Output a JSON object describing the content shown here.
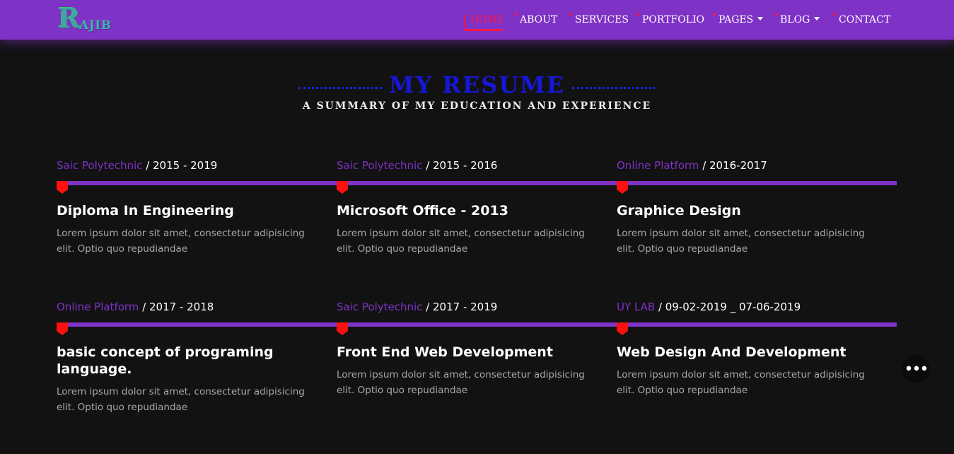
{
  "brand": {
    "logo_letter": "R",
    "logo_text": "AJIB"
  },
  "nav": {
    "items": [
      {
        "label": "HOME",
        "active": true
      },
      {
        "label": "ABOUT"
      },
      {
        "label": "SERVICES"
      },
      {
        "label": "PORTFOLIO"
      },
      {
        "label": "PAGES",
        "dropdown": true
      },
      {
        "label": "BLOG",
        "dropdown": true
      },
      {
        "label": "CONTACT"
      }
    ]
  },
  "section": {
    "title": "MY RESUME",
    "subtitle": "A summary of my education and experience"
  },
  "rows": [
    [
      {
        "place": "Saic Polytechnic",
        "period": " / 2015 - 2019",
        "title": "Diploma In Engineering",
        "desc": "Lorem ipsum dolor sit amet, consectetur adipisicing elit. Optio quo repudiandae"
      },
      {
        "place": "Saic Polytechnic",
        "period": " / 2015 - 2016",
        "title": "Microsoft Office - 2013",
        "desc": "Lorem ipsum dolor sit amet, consectetur adipisicing elit. Optio quo repudiandae"
      },
      {
        "place": "Online Platform",
        "period": " / 2016-2017",
        "title": "Graphice Design",
        "desc": "Lorem ipsum dolor sit amet, consectetur adipisicing elit. Optio quo repudiandae"
      }
    ],
    [
      {
        "place": "Online Platform",
        "period": " / 2017 - 2018",
        "title": "basic concept of programing language.",
        "desc": "Lorem ipsum dolor sit amet, consectetur adipisicing elit. Optio quo repudiandae"
      },
      {
        "place": "Saic Polytechnic",
        "period": " / 2017 - 2019",
        "title": "Front End Web Development",
        "desc": "Lorem ipsum dolor sit amet, consectetur adipisicing elit. Optio quo repudiandae"
      },
      {
        "place": "UY LAB",
        "period": " / 09-02-2019 _ 07-06-2019",
        "title": "Web Design And Development",
        "desc": "Lorem ipsum dolor sit amet, consectetur adipisicing elit. Optio quo repudiandae"
      }
    ]
  ],
  "fab": {
    "label": "•••"
  },
  "colors": {
    "nav_bg": "#7f32c6",
    "accent": "#ff1744",
    "title": "#1717d6",
    "page_bg": "#121212"
  }
}
